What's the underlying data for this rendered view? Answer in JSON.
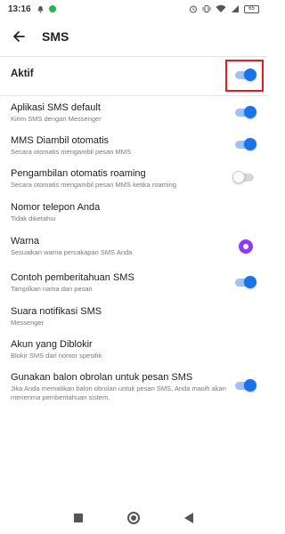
{
  "status_bar": {
    "time": "13:16",
    "battery": "65",
    "icons_left": [
      "notification-bell-icon",
      "whatsapp-icon"
    ],
    "icons_right": [
      "alarm-icon",
      "vibrate-icon",
      "wifi-icon",
      "signal-icon",
      "battery-icon"
    ]
  },
  "header": {
    "title": "SMS",
    "back_icon": "arrow-left-icon"
  },
  "aktif": {
    "label": "Aktif",
    "enabled": true
  },
  "settings": [
    {
      "title": "Aplikasi SMS default",
      "subtitle": "Kirim SMS dengan Messenger",
      "control": "toggle",
      "enabled": true
    },
    {
      "title": "MMS Diambil otomatis",
      "subtitle": "Secara otomatis mengambil pesan MMS",
      "control": "toggle",
      "enabled": true
    },
    {
      "title": "Pengambilan otomatis roaming",
      "subtitle": "Secara otomatis mengambil pesan MMS ketika roaming",
      "control": "toggle",
      "enabled": false
    },
    {
      "title": "Nomor telepon Anda",
      "subtitle": "Tidak diketahui",
      "control": "none"
    },
    {
      "title": "Warna",
      "subtitle": "Sesuaikan warna percakapan SMS Anda",
      "control": "color",
      "color": "#8f3cf0"
    },
    {
      "title": "Contoh pemberitahuan SMS",
      "subtitle": "Tampilkan nama dan pesan",
      "control": "toggle",
      "enabled": true
    },
    {
      "title": "Suara notifikasi SMS",
      "subtitle": "Messenger",
      "control": "none"
    },
    {
      "title": "Akun yang Diblokir",
      "subtitle": "Blokir SMS dari nomor spesifik",
      "control": "none"
    },
    {
      "title": "Gunakan balon obrolan untuk pesan SMS",
      "subtitle": "Jika Anda mematikan balon obrolan untuk pesan SMS, Anda masih akan menerima pemberitahuan sistem.",
      "control": "toggle",
      "enabled": true
    }
  ],
  "colors": {
    "accent": "#1a73e8",
    "highlight": "#e31b23",
    "purple": "#8f3cf0"
  },
  "nav_bar": {
    "icons": [
      "recents-square-icon",
      "home-circle-icon",
      "back-triangle-icon"
    ]
  }
}
